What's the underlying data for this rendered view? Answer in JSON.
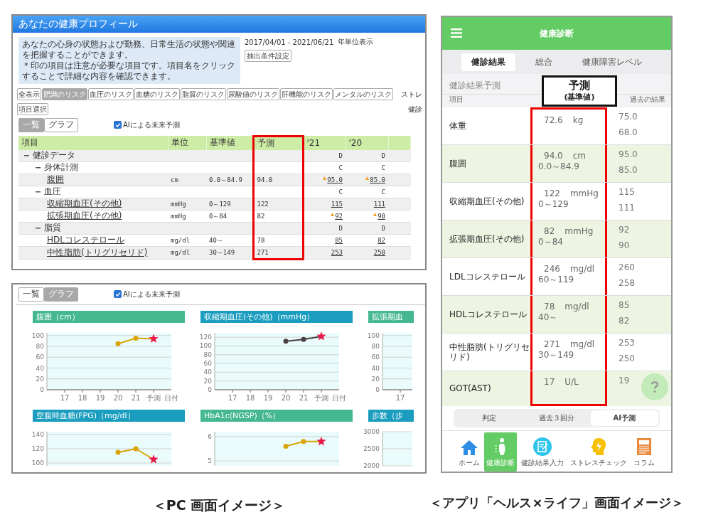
{
  "pc_table_view": {
    "title": "あなたの健康プロフィール",
    "description": [
      "あなたの心身の状態および勤務、日常生活の状態や関連を把握することができます。",
      "＊印の項目は注意が必要な項目です。項目名をクリックすることで詳細な内容を確認できます。"
    ],
    "date_range": "2017/04/01 - 2021/06/21",
    "display_unit": "年単位表示",
    "filter_button": "抽出条件設定",
    "risk_filters": [
      {
        "label": "全表示",
        "selected": false
      },
      {
        "label": "肥満のリスク",
        "selected": true
      },
      {
        "label": "血圧のリスク",
        "selected": false
      },
      {
        "label": "血糖のリスク",
        "selected": false
      },
      {
        "label": "脂質のリスク",
        "selected": false
      },
      {
        "label": "尿酸値のリスク",
        "selected": false
      },
      {
        "label": "肝機能のリスク",
        "selected": false
      },
      {
        "label": "メンタルのリスク",
        "selected": false
      }
    ],
    "item_select_button": "項目選択",
    "side_labels": [
      "ストレ",
      "健診"
    ],
    "view_toggle": [
      {
        "label": "一覧",
        "selected": true
      },
      {
        "label": "グラフ",
        "selected": false
      }
    ],
    "ai_prediction": {
      "label": "AIによる未来予測",
      "checked": true
    },
    "table": {
      "columns": [
        {
          "label": "項目",
          "highlighted": false
        },
        {
          "label": "単位",
          "highlighted": false
        },
        {
          "label": "基準値",
          "highlighted": false
        },
        {
          "label": "予測",
          "highlighted": true
        },
        {
          "label": "'21",
          "highlighted": false
        },
        {
          "label": "'20",
          "highlighted": false
        }
      ],
      "rows": [
        {
          "name": "健診データ",
          "expanded": true,
          "values": [
            {
              "text": "D",
              "flagged": false
            },
            {
              "text": "D",
              "flagged": false
            }
          ],
          "children": [
            {
              "name": "身体計測",
              "expanded": true,
              "values": [
                {
                  "text": "C",
                  "flagged": false
                },
                {
                  "text": "C",
                  "flagged": false
                }
              ],
              "children": [
                {
                  "name": "腹囲",
                  "unit": "cm",
                  "reference": "0.0～84.9",
                  "prediction": "94.0",
                  "values": [
                    {
                      "text": "95.0",
                      "flagged": true
                    },
                    {
                      "text": "85.0",
                      "flagged": true
                    }
                  ]
                }
              ]
            },
            {
              "name": "血圧",
              "expanded": true,
              "values": [
                {
                  "text": "C",
                  "flagged": false
                },
                {
                  "text": "C",
                  "flagged": false
                }
              ],
              "children": [
                {
                  "name": "収縮期血圧(その他)",
                  "unit": "mmHg",
                  "reference": "0～129",
                  "prediction": "122",
                  "values": [
                    {
                      "text": "115",
                      "flagged": false
                    },
                    {
                      "text": "111",
                      "flagged": false
                    }
                  ]
                },
                {
                  "name": "拡張期血圧(その他)",
                  "unit": "mmHg",
                  "reference": "0～84",
                  "prediction": "82",
                  "values": [
                    {
                      "text": "92",
                      "flagged": true
                    },
                    {
                      "text": "90",
                      "flagged": true
                    }
                  ]
                }
              ]
            },
            {
              "name": "脂質",
              "expanded": true,
              "values": [
                {
                  "text": "D",
                  "flagged": false
                },
                {
                  "text": "D",
                  "flagged": false
                }
              ],
              "children": [
                {
                  "name": "HDLコレステロール",
                  "unit": "mg/dl",
                  "reference": "40～",
                  "prediction": "78",
                  "values": [
                    {
                      "text": "85",
                      "flagged": false
                    },
                    {
                      "text": "82",
                      "flagged": false
                    }
                  ]
                },
                {
                  "name": "中性脂肪(トリグリセリド)",
                  "unit": "mg/dl",
                  "reference": "30～149",
                  "prediction": "271",
                  "values": [
                    {
                      "text": "253",
                      "flagged": false
                    },
                    {
                      "text": "250",
                      "flagged": false
                    }
                  ]
                }
              ]
            }
          ]
        }
      ]
    }
  },
  "pc_graph_view": {
    "view_toggle": [
      {
        "label": "一覧",
        "selected": false
      },
      {
        "label": "グラフ",
        "selected": true
      }
    ],
    "ai_prediction": {
      "label": "AIによる未来予測",
      "checked": true
    },
    "charts": [
      {
        "color": "#45b890",
        "chart_data": {
          "type": "line",
          "title": "腹囲（cm）",
          "xlabel": "日付",
          "categories": [
            "17",
            "18",
            "19",
            "20",
            "21",
            "予測"
          ],
          "ylim": [
            0,
            105
          ],
          "yticks": [
            0,
            20,
            40,
            60,
            80,
            100
          ],
          "grid": true,
          "series": [
            {
              "color": "#d9a400",
              "marker": "o",
              "values": [
                null,
                null,
                null,
                85,
                95,
                94
              ]
            }
          ]
        }
      },
      {
        "color": "#1a9dbf",
        "chart_data": {
          "type": "line",
          "title": "収縮期血圧(その他)（mmHg）",
          "xlabel": "日付",
          "categories": [
            "17",
            "18",
            "19",
            "20",
            "21",
            "予測"
          ],
          "ylim": [
            0,
            130
          ],
          "yticks": [
            0,
            20,
            40,
            60,
            80,
            100,
            120
          ],
          "grid": true,
          "series": [
            {
              "color": "#4a4040",
              "marker": "o",
              "values": [
                null,
                null,
                null,
                111,
                115,
                122
              ]
            }
          ]
        }
      },
      {
        "color": "#45b890",
        "chart_data": {
          "type": "line",
          "title": "拡張期血",
          "categories": [
            "17"
          ],
          "ylim": [
            0,
            105
          ],
          "yticks": [
            0,
            20,
            40,
            60,
            80,
            100
          ],
          "grid": true
        }
      },
      {
        "color": "#1a9dbf",
        "chart_data": {
          "type": "line",
          "title": "空腹時血糖(FPG)（mg/dl）",
          "categories": [
            null,
            null,
            null,
            null,
            null,
            null
          ],
          "ylim": [
            96,
            144
          ],
          "yticks": [
            100,
            120,
            140
          ],
          "grid": true,
          "series": [
            {
              "color": "#d9a400",
              "marker": "o",
              "values": [
                null,
                null,
                null,
                115,
                120,
                105
              ]
            }
          ]
        }
      },
      {
        "color": "#45b890",
        "chart_data": {
          "type": "line",
          "title": "HbA1c(NGSP)（%）",
          "categories": [
            null,
            null,
            null,
            null,
            null,
            null
          ],
          "ylim": [
            4.8,
            6.2
          ],
          "yticks": [
            5,
            6
          ],
          "grid": true,
          "series": [
            {
              "color": "#d9a400",
              "marker": "o",
              "values": [
                null,
                null,
                null,
                5.6,
                5.8,
                5.8
              ]
            }
          ]
        }
      },
      {
        "color": "#1a9dbf",
        "chart_data": {
          "type": "line",
          "title": "歩数（歩",
          "categories": [
            null,
            null,
            null,
            null,
            null,
            null
          ],
          "ylim": [
            2000,
            3000
          ],
          "yticks": [
            2000,
            2500,
            3000
          ],
          "grid": true
        }
      }
    ]
  },
  "app": {
    "title": "健康診断",
    "tabs": [
      {
        "label": "健診結果",
        "selected": true
      },
      {
        "label": "総合",
        "selected": false
      },
      {
        "label": "健康障害レベル",
        "selected": false
      }
    ],
    "section_title": "健診結果予測",
    "callout": {
      "title": "予測",
      "subtitle": "(基準値)"
    },
    "columns": [
      "項目",
      "過去の結果"
    ],
    "prediction_highlighted": true,
    "rows": [
      {
        "name": "体重",
        "value": "72.6",
        "unit": "kg",
        "past": [
          "75.0",
          "68.0"
        ]
      },
      {
        "name": "腹囲",
        "value": "94.0",
        "unit": "cm",
        "reference": "0.0～84.9",
        "past": [
          "95.0",
          "85.0"
        ]
      },
      {
        "name": "収縮期血圧(その他)",
        "value": "122",
        "unit": "mmHg",
        "reference": "0～129",
        "past": [
          "115",
          "111"
        ]
      },
      {
        "name": "拡張期血圧(その他)",
        "value": "82",
        "unit": "mmHg",
        "reference": "0～84",
        "past": [
          "92",
          "90"
        ]
      },
      {
        "name": "LDLコレステロール",
        "value": "246",
        "unit": "mg/dl",
        "reference": "60～119",
        "past": [
          "260",
          "258"
        ]
      },
      {
        "name": "HDLコレステロール",
        "value": "78",
        "unit": "mg/dl",
        "reference": "40～",
        "past": [
          "85",
          "82"
        ]
      },
      {
        "name": "中性脂肪(トリグリセリド)",
        "value": "271",
        "unit": "mg/dl",
        "reference": "30～149",
        "past": [
          "253",
          "250"
        ]
      },
      {
        "name": "GOT(AST)",
        "value": "17",
        "unit": "U/L",
        "past": [
          "19"
        ]
      }
    ],
    "view_modes": [
      {
        "label": "判定",
        "selected": false
      },
      {
        "label": "過去３回分",
        "selected": false
      },
      {
        "label": "AI予測",
        "selected": true
      }
    ],
    "nav": [
      {
        "label": "ホーム",
        "kind": "home",
        "selected": false
      },
      {
        "label": "健康診断",
        "kind": "body",
        "selected": true
      },
      {
        "label": "健診結果入力",
        "kind": "memo",
        "selected": false
      },
      {
        "label": "ストレスチェック",
        "kind": "head",
        "selected": false
      },
      {
        "label": "コラム",
        "kind": "newspaper",
        "selected": false
      }
    ]
  },
  "captions": [
    "＜PC 画面イメージ＞",
    "＜アプリ「ヘルス×ライフ」画面イメージ＞"
  ]
}
